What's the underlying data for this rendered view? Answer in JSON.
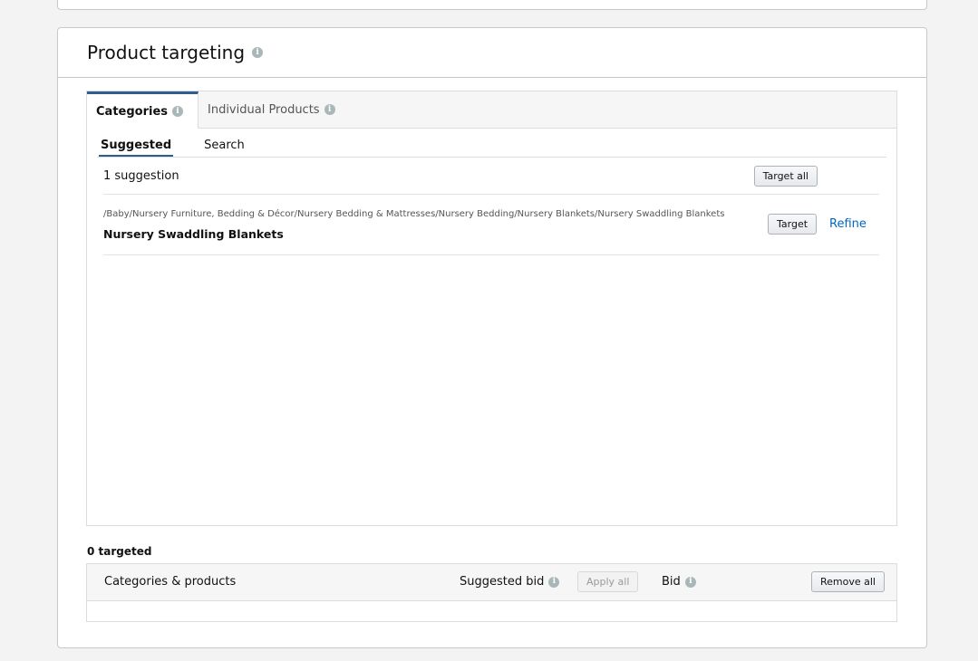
{
  "card": {
    "title": "Product targeting"
  },
  "tabs": [
    {
      "label": "Categories",
      "active": true
    },
    {
      "label": "Individual Products",
      "active": false
    }
  ],
  "subtabs": [
    {
      "label": "Suggested",
      "active": true
    },
    {
      "label": "Search",
      "active": false
    }
  ],
  "suggestions": {
    "count_label": "1 suggestion",
    "target_all_label": "Target all",
    "items": [
      {
        "path": "/Baby/Nursery Furniture, Bedding & Décor/Nursery Bedding & Mattresses/Nursery Bedding/Nursery Blankets/Nursery Swaddling Blankets",
        "name": "Nursery Swaddling Blankets",
        "target_label": "Target",
        "refine_label": "Refine"
      }
    ]
  },
  "targeted": {
    "count_label": "0 targeted",
    "columns": {
      "categories": "Categories & products",
      "suggested_bid": "Suggested bid",
      "apply_all": "Apply all",
      "bid": "Bid",
      "remove_all": "Remove all"
    }
  },
  "colors": {
    "accent": "#2f5d8f",
    "link": "#0066c0"
  },
  "icons": {
    "info": "info-icon"
  }
}
